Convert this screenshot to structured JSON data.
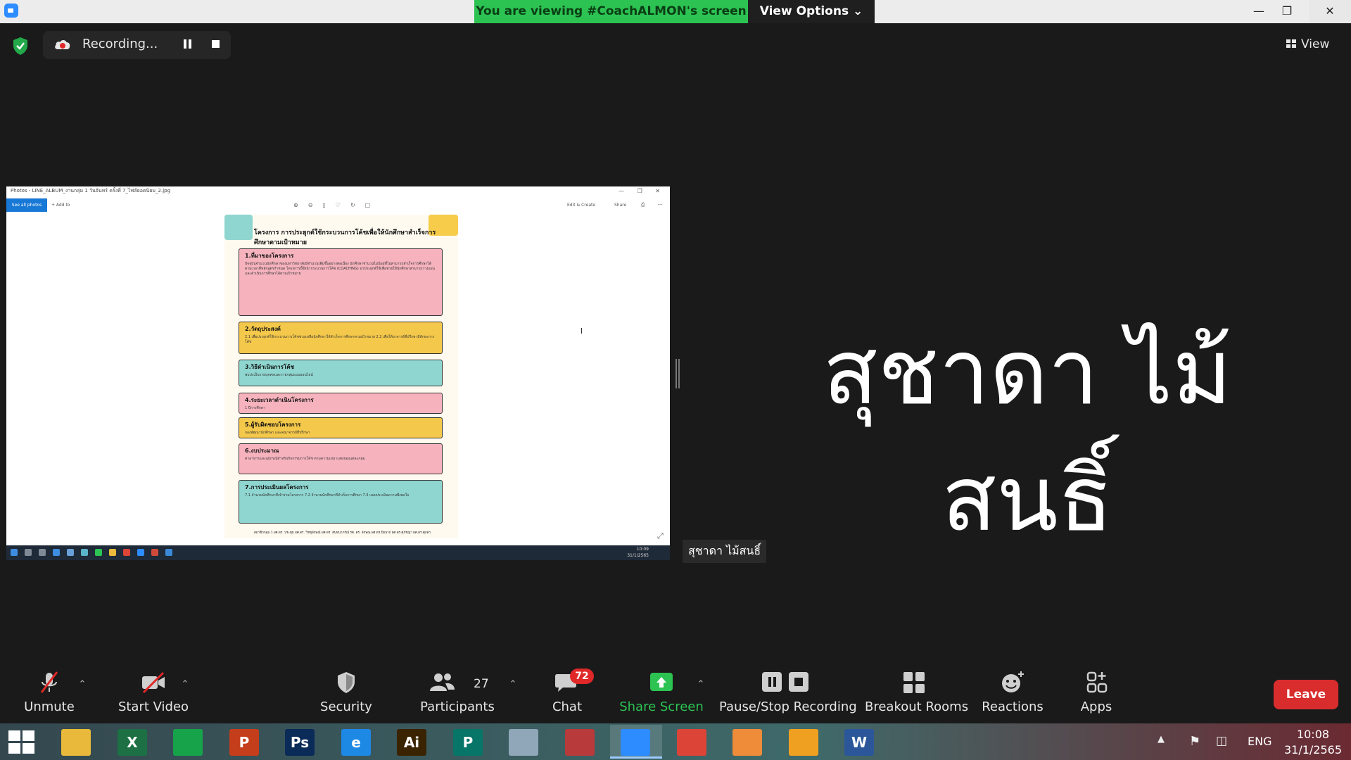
{
  "banner": {
    "viewing_text": "You are viewing #CoachALMON's screen",
    "view_options_label": "View Options"
  },
  "recording": {
    "label": "Recording..."
  },
  "view_button": {
    "label": "View"
  },
  "shared_screen": {
    "window_title": "Photos - LINE_ALBUM_งานกลุ่ม 1 วันจันทร์ ครั้งที่ 7_ไฟล์ยอดนิยม_2.jpg",
    "see_all_label": "See all photos",
    "add_to_label": "+ Add to",
    "edit_create_label": "Edit & Create",
    "share_label": "Share",
    "inner_clock_time": "10:09",
    "inner_clock_date": "31/1/2565",
    "poster": {
      "title": "โครงการ การประยุกต์ใช้กระบวนการโค้ชเพื่อให้นักศึกษาสำเร็จการศึกษาตามเป้าหมาย",
      "sections": [
        {
          "title": "1.ที่มาของโครงการ",
          "body": "ปัจจุบันจำนวนนักศึกษาของมหาวิทยาลัยมีจำนวนเพิ่มขึ้นอย่างต่อเนื่อง นักศึกษาจำนวนไม่น้อยที่ไม่สามารถสำเร็จการศึกษาได้ตามเวลาที่หลักสูตรกำหนด โครงการนี้จึงนำกระบวนการโค้ช (COACHING) มาประยุกต์ใช้เพื่อช่วยให้นักศึกษาสามารถวางแผนและดำเนินการศึกษาได้ตามเป้าหมาย"
        },
        {
          "title": "2.วัตถุประสงค์",
          "body": "2.1 เพื่อประยุกต์ใช้กระบวนการโค้ชช่วยเหลือนักศึกษาให้สำเร็จการศึกษาตามเป้าหมาย 2.2 เพื่อให้อาจารย์ที่ปรึกษามีทักษะการโค้ช"
        },
        {
          "title": "3.วิธีดำเนินการโค้ช",
          "body": "พบปะเป็นรายบุคคลและรายกลุ่มแบบออนไลน์"
        },
        {
          "title": "4.ระยะเวลาดำเนินโครงการ",
          "body": "1 ปีการศึกษา"
        },
        {
          "title": "5.ผู้รับผิดชอบโครงการ",
          "body": "กองพัฒนานักศึกษา และคณาจารย์ที่ปรึกษา"
        },
        {
          "title": "6.งบประมาณ",
          "body": "ค่าอาหารและอุปกรณ์สำหรับกิจกรรมการโค้ช ตามความเหมาะสมของแต่ละกลุ่ม"
        },
        {
          "title": "7.การประเมินผลโครงการ",
          "body": "7.1 จำนวนนักศึกษาที่เข้าร่วมโครงการ 7.2 จำนวนนักศึกษาที่สำเร็จการศึกษา 7.3 แบบประเมินความพึงพอใจ"
        }
      ],
      "footer": "สมาชิกกลุ่ม 1 ผศ.ดร. ประทุม ผศ.ดร. วิชชุลักษณ์ ผศ.ดร. สันทนาภรณ์ รศ. ดร. ลักษณ ผศ.ดร.ปิยนาถ ผศ.ดร.ศุภัชญา ผศ.ดร.ศุภดา"
    }
  },
  "participant": {
    "display_name": "สุชาดา ไม้สนธิ์",
    "name_tag": "สุชาดา ไม้สนธิ์"
  },
  "toolbar": {
    "unmute": "Unmute",
    "start_video": "Start Video",
    "security": "Security",
    "participants": "Participants",
    "participants_count": "27",
    "chat": "Chat",
    "chat_badge": "72",
    "share_screen": "Share Screen",
    "pause_stop_recording": "Pause/Stop Recording",
    "breakout_rooms": "Breakout Rooms",
    "reactions": "Reactions",
    "apps": "Apps",
    "leave": "Leave"
  },
  "taskbar": {
    "apps": [
      {
        "name": "file-explorer",
        "label": "",
        "color": "#e8b93a"
      },
      {
        "name": "excel",
        "label": "X",
        "color": "#1d7044"
      },
      {
        "name": "store",
        "label": "",
        "color": "#16a34a"
      },
      {
        "name": "powerpoint",
        "label": "P",
        "color": "#c43e1c"
      },
      {
        "name": "photoshop",
        "label": "Ps",
        "color": "#0a2a57"
      },
      {
        "name": "internet-explorer",
        "label": "e",
        "color": "#1e88e5"
      },
      {
        "name": "illustrator",
        "label": "Ai",
        "color": "#3a2300"
      },
      {
        "name": "publisher",
        "label": "P",
        "color": "#077568"
      },
      {
        "name": "pen-tool",
        "label": "",
        "color": "#8fa7b8"
      },
      {
        "name": "photoscape",
        "label": "",
        "color": "#b83a3a"
      },
      {
        "name": "zoom",
        "label": "",
        "color": "#2d8cff"
      },
      {
        "name": "chrome",
        "label": "",
        "color": "#db4437"
      },
      {
        "name": "photo-app",
        "label": "",
        "color": "#ee8c3a"
      },
      {
        "name": "camera-app",
        "label": "",
        "color": "#f0a020"
      },
      {
        "name": "word",
        "label": "W",
        "color": "#2b579a"
      }
    ],
    "language": "ENG",
    "time": "10:08",
    "date": "31/1/2565"
  },
  "colors": {
    "banner_green": "#2cc353",
    "share_green": "#2cc353",
    "leave_red": "#d92d2d",
    "badge_red": "#e02828"
  }
}
